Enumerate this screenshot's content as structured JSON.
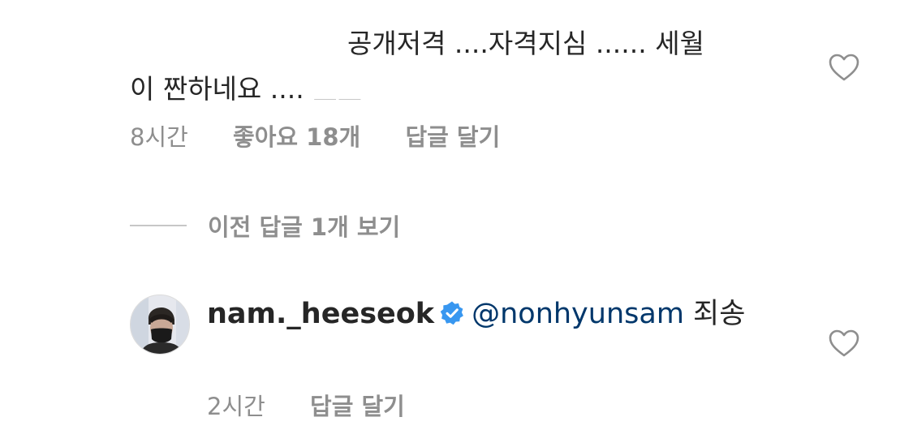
{
  "comment1": {
    "line1": "공개저격 ....자격지심 ...... 세월",
    "line2": "이 짠하네요 .... ",
    "line3": "ㅜㅜ",
    "time": "8시간",
    "likes": "좋아요 18개",
    "reply_label": "답글 달기",
    "like_icon": "heart-outline-icon"
  },
  "view_replies": {
    "label": "이전 답글 1개 보기"
  },
  "comment2": {
    "username": "nam._heeseok",
    "verified_icon": "verified-badge-icon",
    "mention": "@nonhyunsam",
    "text": " 죄송",
    "time": "2시간",
    "reply_label": "답글 달기",
    "like_icon": "heart-outline-icon"
  },
  "colors": {
    "text": "#262626",
    "secondary": "#8e8e8e",
    "mention": "#00376b",
    "verified": "#3897f0"
  }
}
